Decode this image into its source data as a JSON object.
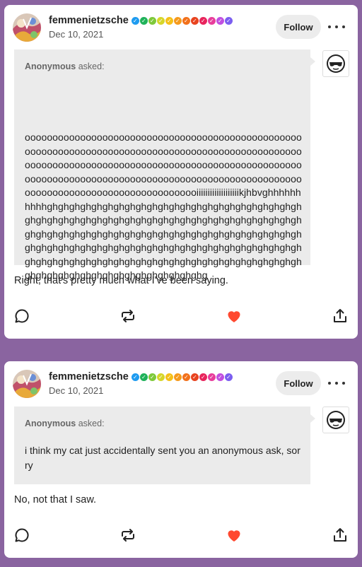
{
  "posts": [
    {
      "username": "femmenietzsche",
      "date": "Dec 10, 2021",
      "follow_label": "Follow",
      "asker": "Anonymous",
      "asked_suffix": " asked:",
      "question": "oooooooooooooooooooooooooooooooooooooooooooooooooooooooooooooooooooooooooooooooooooooooooooooooooooooooooooooooooooooooooooooooooooooooooooooooooooooooooooooooooooooooooooooooooooooooooooooooooooooooooooooooooooooooooooooooooooooooiiiiiiiiiiiiiiiiiiikjhbvghhhhhhhhhhghghghghghghghghghghghghghghghghghghghghghghghghghghghghghghghghghghghghghghghghghghghghghghghghghghghghghghghghghghghghghghghghghghghghghghghghghghghghghghghghghghghghghghghghghghghghghghghghghghghghghghghghghghghghghghghghghghghghghghghghghghghghghghghghghghghghghghghghghghghg",
      "answer": "Right, that's pretty much what I've been saying."
    },
    {
      "username": "femmenietzsche",
      "date": "Dec 10, 2021",
      "follow_label": "Follow",
      "asker": "Anonymous",
      "asked_suffix": " asked:",
      "question": "i think my cat just accidentally sent you an anonymous ask, sorry",
      "answer": "No, not that I saw."
    }
  ],
  "badges": [
    "#1e9bf0",
    "#1fb25a",
    "#7ec93a",
    "#d6d62a",
    "#f5c019",
    "#f59a1c",
    "#f2711b",
    "#e8431f",
    "#e8245c",
    "#e83d9b",
    "#c04fe0",
    "#7b5ef0"
  ],
  "colors": {
    "like": "#ff4930",
    "accent_bg": "#8a64a0"
  },
  "icons": [
    "reply-icon",
    "reblog-icon",
    "like-icon",
    "share-icon",
    "more-icon",
    "follow-button"
  ]
}
